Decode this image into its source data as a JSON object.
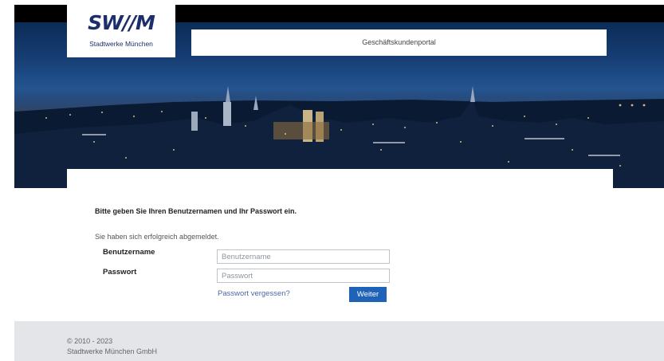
{
  "header": {
    "logo_text": "SW//M",
    "logo_subtitle": "Stadtwerke München",
    "portal_title": "Geschäftskundenportal"
  },
  "login": {
    "headline": "Bitte geben Sie Ihren Benutzernamen und Ihr Passwort ein.",
    "message": "Sie haben sich erfolgreich abgemeldet.",
    "username_label": "Benutzername",
    "username_placeholder": "Benutzername",
    "username_value": "",
    "password_label": "Passwort",
    "password_placeholder": "Passwort",
    "password_value": "",
    "forgot_link": "Passwort vergessen?",
    "submit_label": "Weiter"
  },
  "footer": {
    "copyright": "© 2010 - 2023",
    "company": "Stadtwerke München GmbH"
  },
  "colors": {
    "brand_navy": "#1c2f6b",
    "button_blue": "#1f63b8",
    "link_blue": "#4a6aa6",
    "footer_bg": "#e3e5e8"
  }
}
